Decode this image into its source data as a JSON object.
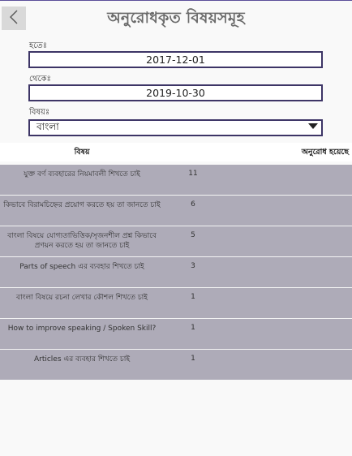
{
  "header": {
    "title": "অনুরোধকৃত বিষয়সমূহ",
    "back_icon": "chevron-left-icon"
  },
  "filters": {
    "from_label": "হতেঃ",
    "from_value": "2017-12-01",
    "to_label": "থেকেঃ",
    "to_value": "2019-10-30",
    "subject_label": "বিষয়ঃ",
    "subject_value": "বাংলা"
  },
  "table": {
    "headers": {
      "subject": "বিষয়",
      "count": "অনুরোধ হয়েছে"
    },
    "rows": [
      {
        "subject": "যুক্ত বর্ণ ব্যবহারের নিয়মাবলী শিখতে চাই",
        "count": "11"
      },
      {
        "subject": "কিভাবে বিরামচিহ্নের প্রয়োগ করতে হয় তা জানতে চাই",
        "count": "6"
      },
      {
        "subject": "বাংলা বিষয়ে যোগ্যতাভিত্তিক/সৃজনশীল প্রশ্ন কিভাবে প্রণয়ন করতে হয় তা জানতে চাই",
        "count": "5"
      },
      {
        "subject": "Parts of speech এর ব্যবহার শিখতে চাই",
        "count": "3"
      },
      {
        "subject": "বাংলা বিষয়ে রচনা লেখার কৌশল শিখতে চাই",
        "count": "1"
      },
      {
        "subject": "How to improve speaking / Spoken Skill?",
        "count": "1"
      },
      {
        "subject": "Articles এর ব্যবহার শিখতে চাই",
        "count": "1"
      }
    ]
  },
  "colors": {
    "accent": "#3d3566",
    "row_bg": "#aeabb8",
    "title": "#6b6b6b"
  }
}
